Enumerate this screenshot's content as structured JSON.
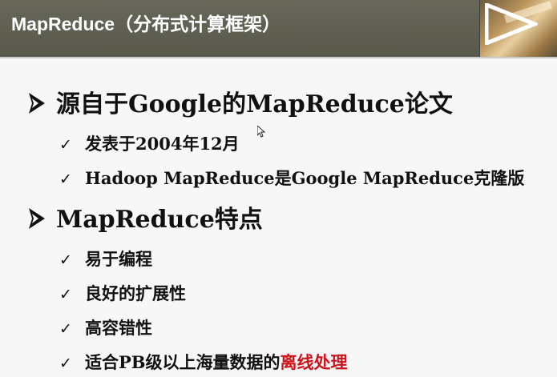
{
  "header": {
    "title": "MapReduce（分布式计算框架）",
    "icon": "play-arrow-icon"
  },
  "sections": [
    {
      "heading": "源自于Google的MapReduce论文",
      "items": [
        "发表于2004年12月",
        "Hadoop MapReduce是Google MapReduce克隆版"
      ]
    },
    {
      "heading": "MapReduce特点",
      "items": [
        "易于编程",
        "良好的扩展性",
        "高容错性"
      ],
      "last_item": {
        "text": "适合PB级以上海量数据的",
        "highlight": "离线处理"
      }
    }
  ],
  "icons": {
    "heading_bullet": "arrow-bullet-icon",
    "item_bullet": "checkmark-icon",
    "check_glyph": "✓",
    "cursor": "mouse-cursor-icon"
  },
  "colors": {
    "header_bg": "#5d5d50",
    "highlight": "#d0121b",
    "background": "#f7f7f7"
  }
}
